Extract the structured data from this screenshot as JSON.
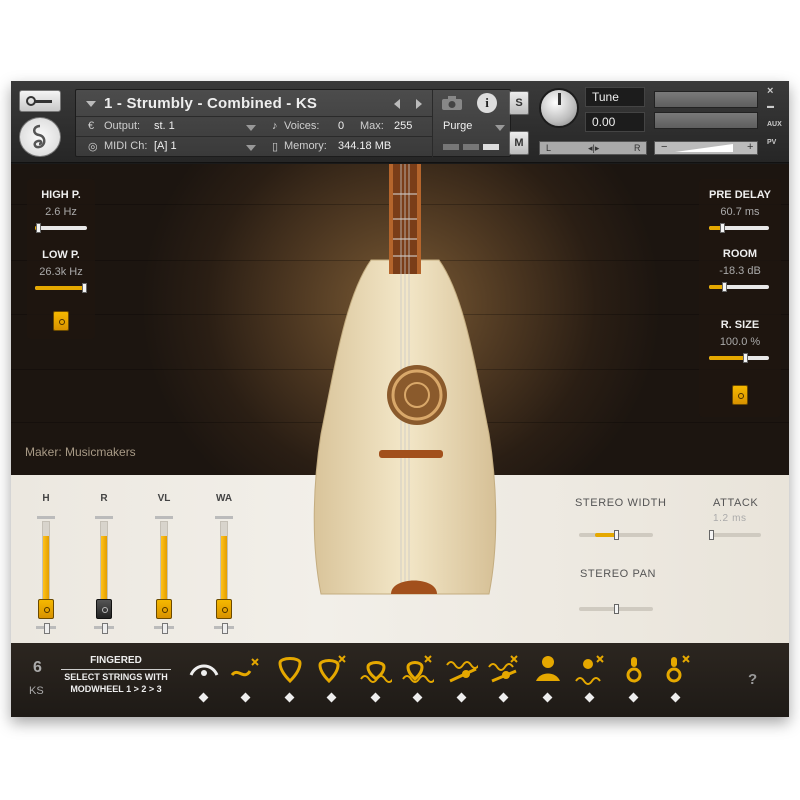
{
  "header": {
    "instrument_name": "1 - Strumbly - Combined - KS",
    "output_label": "Output:",
    "output_value": "st. 1",
    "voices_label": "Voices:",
    "voices_value": "0",
    "max_label": "Max:",
    "max_value": "255",
    "midi_label": "MIDI Ch:",
    "midi_value": "[A]  1",
    "memory_label": "Memory:",
    "memory_value": "344.18 MB",
    "purge_label": "Purge",
    "solo_label": "S",
    "mute_label": "M",
    "tune_label": "Tune",
    "tune_value": "0.00",
    "pan_left": "L",
    "pan_right": "R",
    "vol_minus": "−",
    "vol_plus": "+",
    "close_label": "×",
    "aux_label": "AUX",
    "pv_label": "PV"
  },
  "left_panel": {
    "high_label": "HIGH P.",
    "high_value": "2.6 Hz",
    "high_level": 0.05,
    "low_label": "LOW P.",
    "low_value": "26.3k Hz",
    "low_level": 1.0
  },
  "right_panel": {
    "predelay_label": "PRE DELAY",
    "predelay_value": "60.7 ms",
    "predelay_level": 0.22,
    "room_label": "ROOM",
    "room_value": "-18.3 dB",
    "room_level": 0.25,
    "rsize_label": "R. SIZE",
    "rsize_value": "100.0 %",
    "rsize_level": 0.6
  },
  "maker_text": "Maker: Musicmakers",
  "faders": [
    {
      "label": "H",
      "level": 0.82,
      "toggle": "gold"
    },
    {
      "label": "R",
      "level": 0.82,
      "toggle": "dark"
    },
    {
      "label": "VL",
      "level": 0.82,
      "toggle": "gold"
    },
    {
      "label": "WA",
      "level": 0.82,
      "toggle": "gold"
    }
  ],
  "stereo": {
    "width_label": "STEREO  WIDTH",
    "width_level": 0.5,
    "attack_label": "ATTACK",
    "attack_value": "1.2 ms",
    "pan_label": "STEREO  PAN",
    "pan_level": 0.5
  },
  "bottom": {
    "strings_count": "6",
    "ks_label": "KS",
    "fingered_label": "FINGERED",
    "select_line": "SELECT STRINGS WITH",
    "mod_line": "MODWHEEL 1 > 2 > 3",
    "help_label": "?",
    "articulations": [
      "arc-icon",
      "slide-mute-icon",
      "pick-icon",
      "pick-mute-icon",
      "tremolo-pick-icon",
      "tremolo-pick-mute-icon",
      "wave-strum-icon",
      "wave-strum-mute-icon",
      "drone-icon",
      "drone-mute-icon",
      "harmonic-icon",
      "harmonic-mute-icon"
    ]
  },
  "colors": {
    "accent": "#e5a800",
    "panel_bg": "#1e1610",
    "paper": "#efebe3"
  }
}
